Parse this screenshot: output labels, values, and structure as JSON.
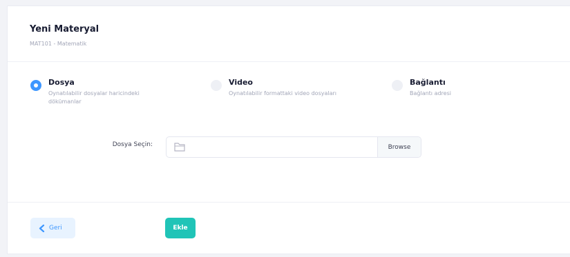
{
  "header": {
    "title": "Yeni Materyal",
    "subtitle": "MAT101 - Matematik"
  },
  "options": [
    {
      "label": "Dosya",
      "desc": "Oynatılabilir dosyalar haricindeki dökümanlar",
      "checked": true
    },
    {
      "label": "Video",
      "desc": "Oynatılabilir formattaki video dosyaları",
      "checked": false
    },
    {
      "label": "Bağlantı",
      "desc": "Bağlantı adresi",
      "checked": false
    }
  ],
  "file_field": {
    "label": "Dosya Seçin:",
    "value": "",
    "browse_label": "Browse"
  },
  "footer": {
    "back_label": "Geri",
    "add_label": "Ekle"
  },
  "colors": {
    "primary": "#3e97ff",
    "primary_light": "#e8f3ff",
    "success": "#20c4b7",
    "text_dark": "#181c32",
    "text_muted": "#a1a5b7"
  },
  "icons": {
    "file": "file-icon",
    "back": "chevron-left-icon"
  }
}
